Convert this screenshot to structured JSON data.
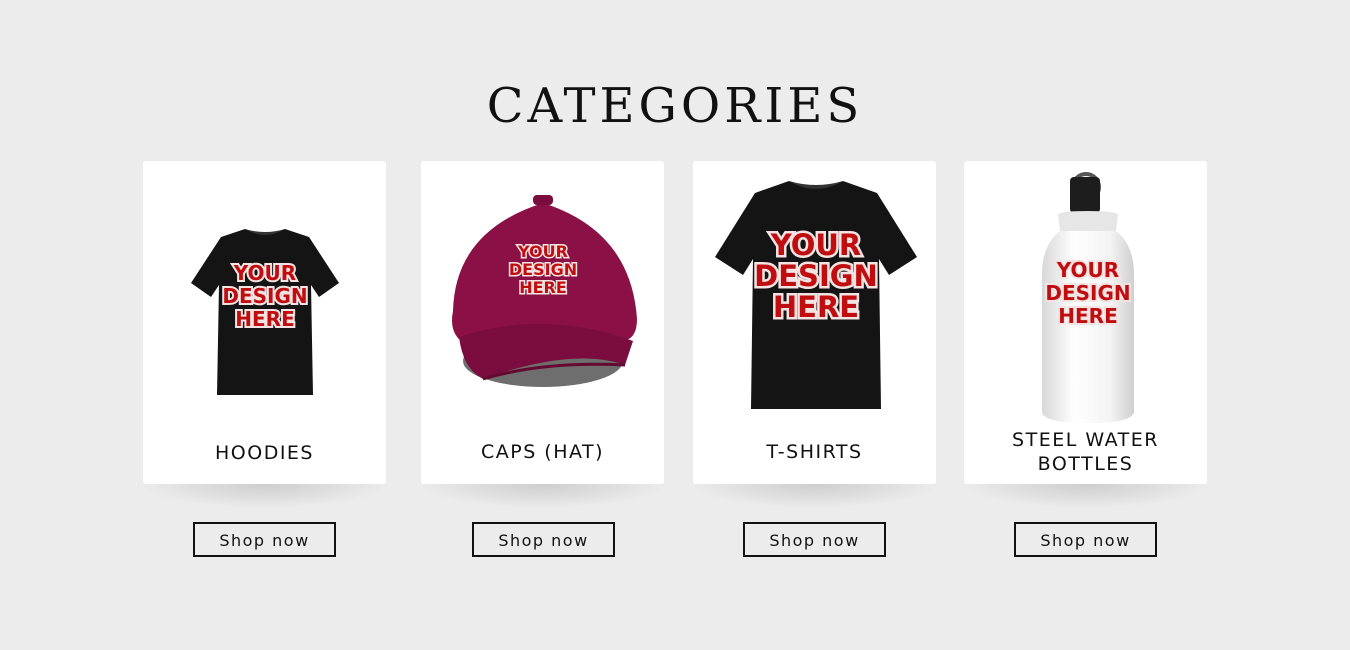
{
  "page": {
    "title": "CATEGORIES"
  },
  "design_text": [
    "YOUR",
    "DESIGN",
    "HERE"
  ],
  "colors": {
    "background": "#ececec",
    "card": "#ffffff",
    "design_red": "#c00d10",
    "cap": "#8a1046",
    "shirt": "#141414"
  },
  "categories": [
    {
      "label": "HOODIES",
      "button": "Shop now",
      "icon": "black-tshirt-icon"
    },
    {
      "label": "CAPS (HAT)",
      "button": "Shop now",
      "icon": "maroon-cap-icon"
    },
    {
      "label": "T-SHIRTS",
      "button": "Shop now",
      "icon": "black-tshirt-icon"
    },
    {
      "label_lines": [
        "STEEL WATER",
        "BOTTLES"
      ],
      "button": "Shop now",
      "icon": "white-water-bottle-icon"
    }
  ]
}
